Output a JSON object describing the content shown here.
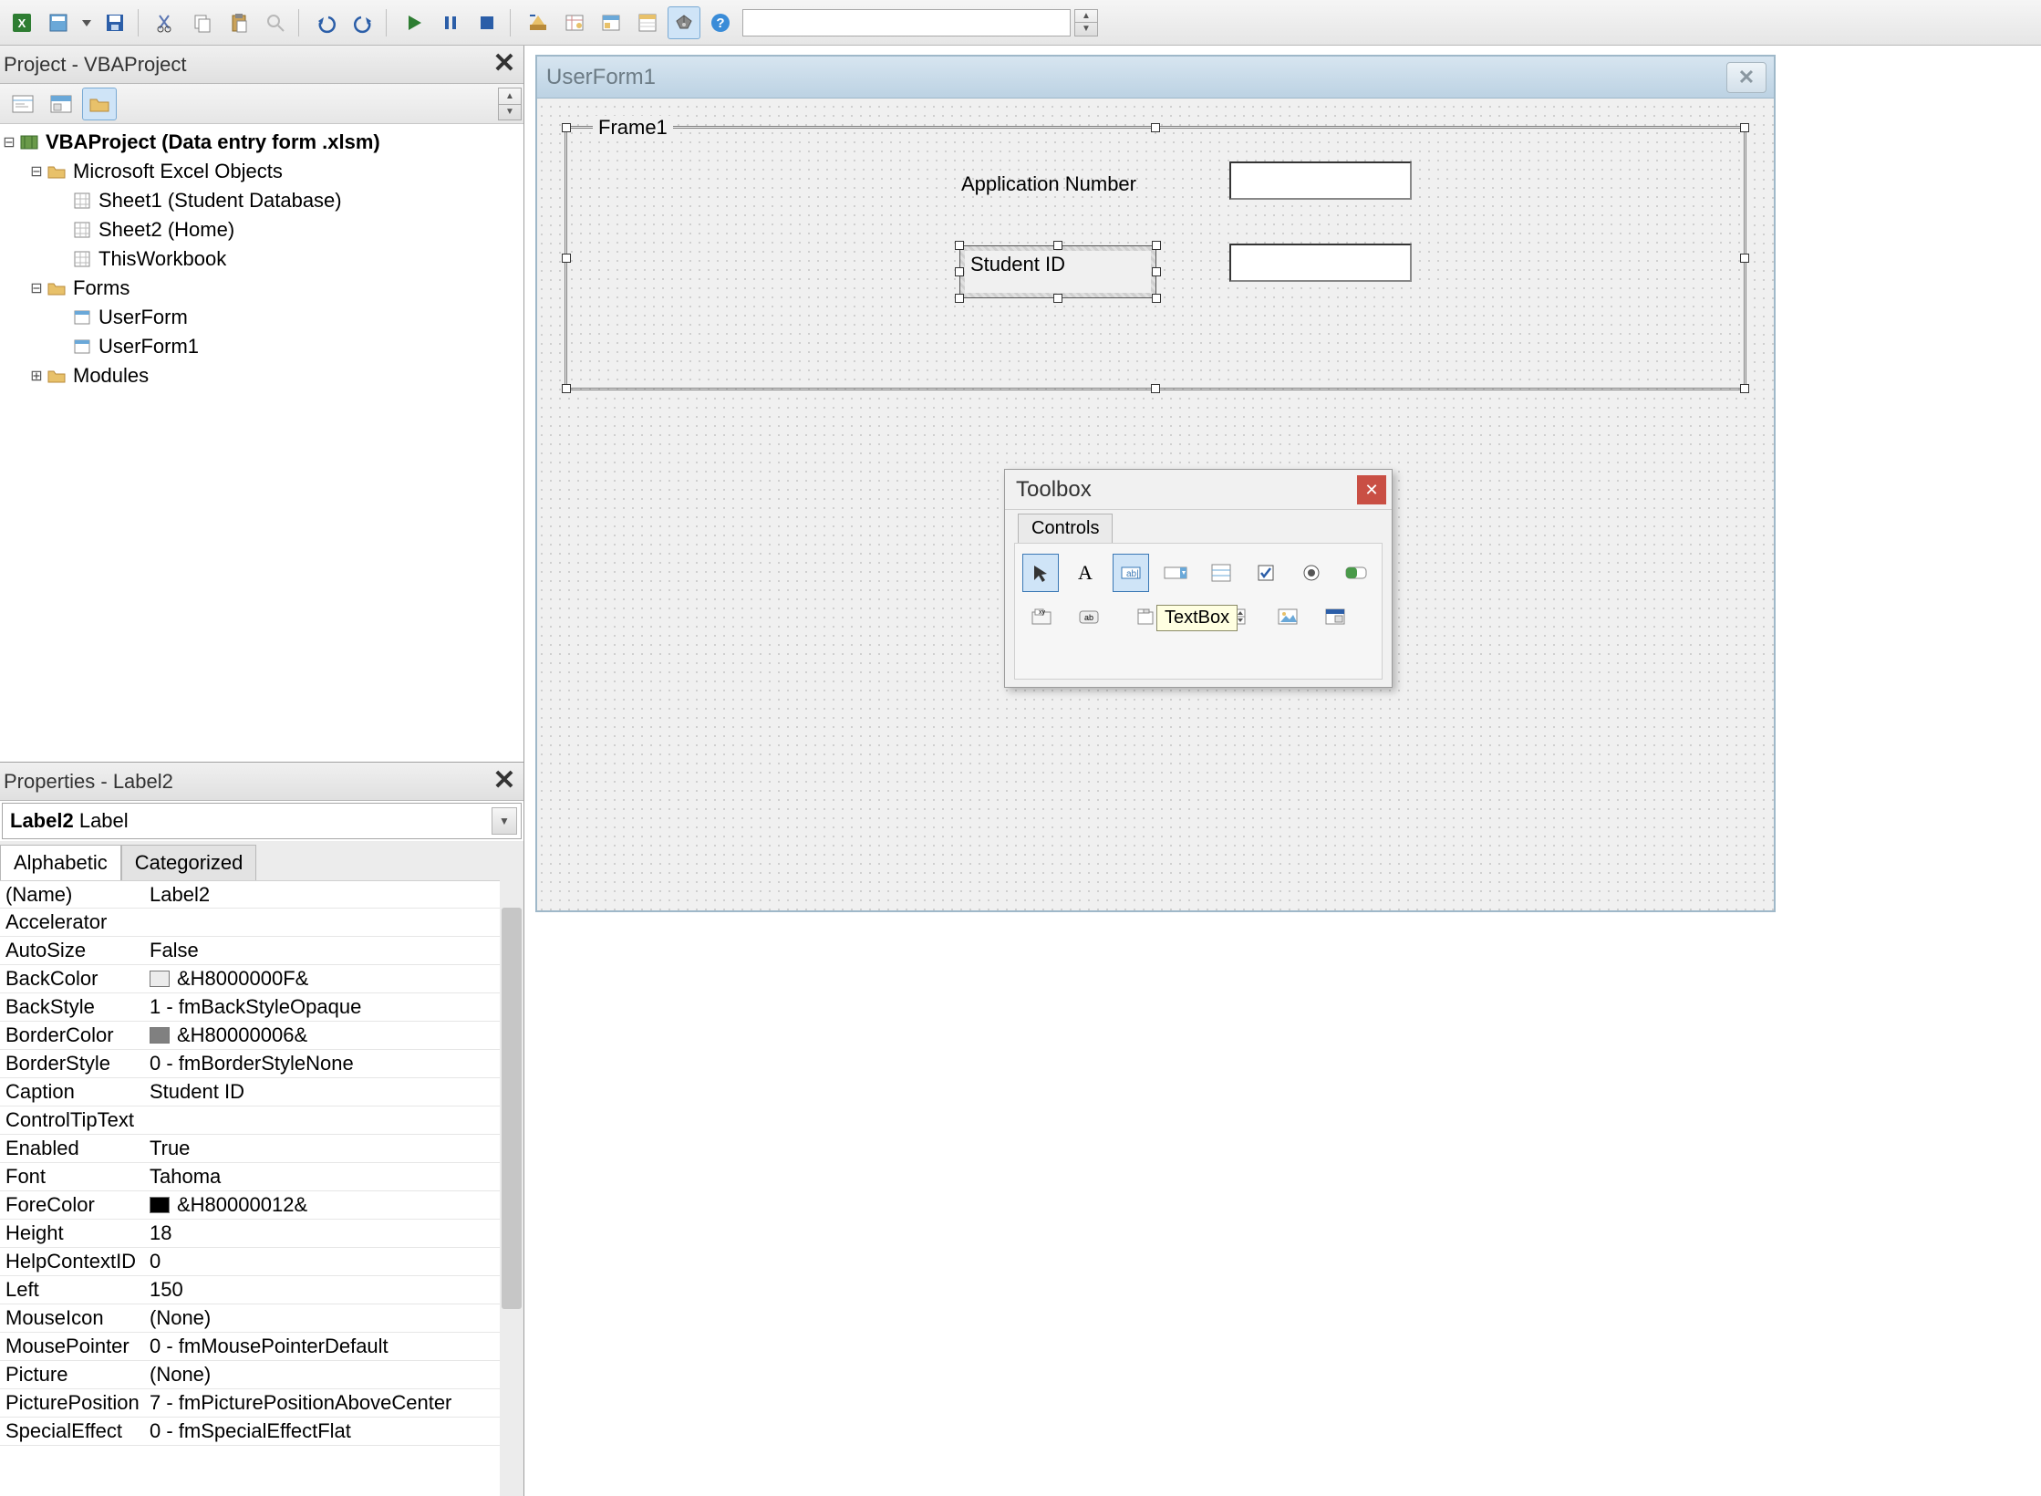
{
  "toolbar": {
    "icons": [
      "excel",
      "insert",
      "dropdown",
      "save",
      "cut",
      "copy",
      "paste",
      "find",
      "undo",
      "redo",
      "run",
      "break",
      "stop",
      "design",
      "object-browser",
      "project-explorer",
      "properties",
      "toolbox",
      "help"
    ]
  },
  "project_explorer": {
    "title": "Project - VBAProject",
    "tree": {
      "root_label": "VBAProject (Data entry form .xlsm)",
      "excel_objects": {
        "label": "Microsoft Excel Objects",
        "items": [
          "Sheet1 (Student Database)",
          "Sheet2 (Home)",
          "ThisWorkbook"
        ]
      },
      "forms": {
        "label": "Forms",
        "items": [
          "UserForm",
          "UserForm1"
        ]
      },
      "modules": {
        "label": "Modules"
      }
    }
  },
  "properties": {
    "title": "Properties - Label2",
    "object_name": "Label2",
    "object_type": "Label",
    "tabs": [
      "Alphabetic",
      "Categorized"
    ],
    "rows": [
      {
        "name": "(Name)",
        "value": "Label2"
      },
      {
        "name": "Accelerator",
        "value": ""
      },
      {
        "name": "AutoSize",
        "value": "False"
      },
      {
        "name": "BackColor",
        "value": "&H8000000F&",
        "swatch": "#ececec"
      },
      {
        "name": "BackStyle",
        "value": "1 - fmBackStyleOpaque"
      },
      {
        "name": "BorderColor",
        "value": "&H80000006&",
        "swatch": "#808080"
      },
      {
        "name": "BorderStyle",
        "value": "0 - fmBorderStyleNone"
      },
      {
        "name": "Caption",
        "value": "Student ID"
      },
      {
        "name": "ControlTipText",
        "value": ""
      },
      {
        "name": "Enabled",
        "value": "True"
      },
      {
        "name": "Font",
        "value": "Tahoma"
      },
      {
        "name": "ForeColor",
        "value": "&H80000012&",
        "swatch": "#000000"
      },
      {
        "name": "Height",
        "value": "18"
      },
      {
        "name": "HelpContextID",
        "value": "0"
      },
      {
        "name": "Left",
        "value": "150"
      },
      {
        "name": "MouseIcon",
        "value": "(None)"
      },
      {
        "name": "MousePointer",
        "value": "0 - fmMousePointerDefault"
      },
      {
        "name": "Picture",
        "value": "(None)"
      },
      {
        "name": "PicturePosition",
        "value": "7 - fmPicturePositionAboveCenter"
      },
      {
        "name": "SpecialEffect",
        "value": "0 - fmSpecialEffectFlat"
      }
    ]
  },
  "form": {
    "title": "UserForm1",
    "frame_caption": "Frame1",
    "labels": {
      "app_number": "Application Number",
      "student_id": "Student ID"
    }
  },
  "toolbox": {
    "title": "Toolbox",
    "tab": "Controls",
    "tooltip": "TextBox",
    "row1": [
      "select",
      "label",
      "textbox",
      "combo",
      "listbox",
      "checkbox",
      "option",
      "toggle"
    ],
    "row2": [
      "frame",
      "command",
      "tabstrip",
      "multipage",
      "scrollbar",
      "spin",
      "image",
      "refedit"
    ]
  }
}
